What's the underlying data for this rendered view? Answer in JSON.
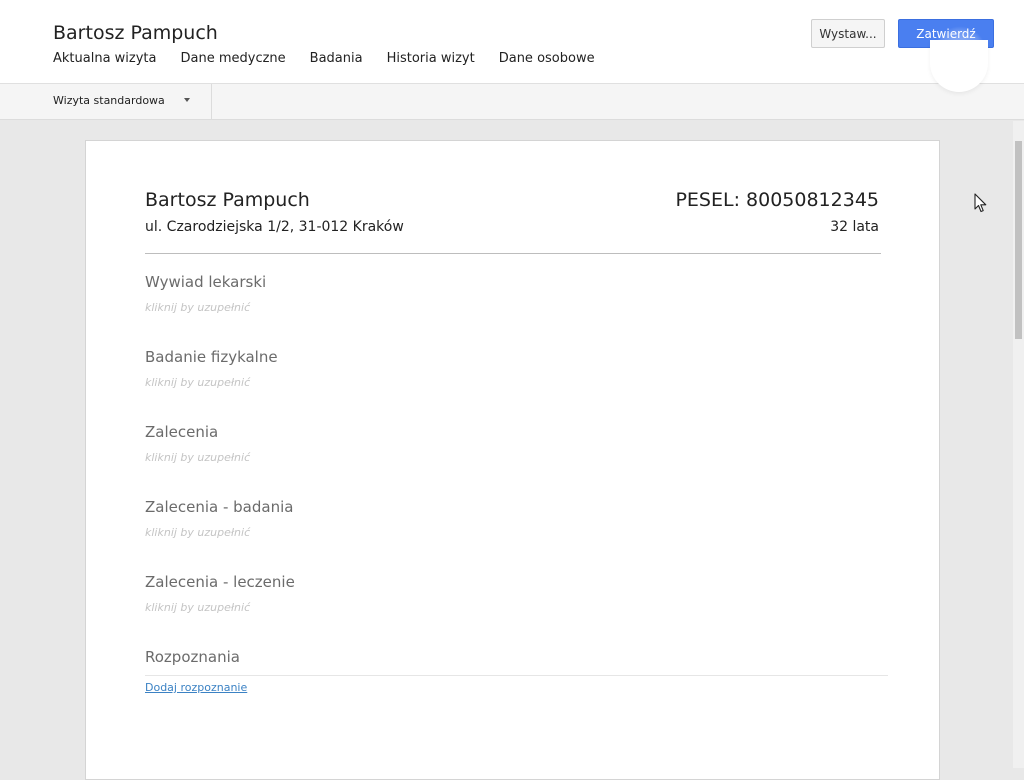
{
  "header": {
    "patient_name": "Bartosz Pampuch",
    "tabs": [
      {
        "label": "Aktualna wizyta"
      },
      {
        "label": "Dane medyczne"
      },
      {
        "label": "Badania"
      },
      {
        "label": "Historia wizyt"
      },
      {
        "label": "Dane osobowe"
      }
    ],
    "issue_button_label": "Wystaw...",
    "confirm_button_label": "Zatwierdź"
  },
  "toolbar": {
    "visit_type": "Wizyta standardowa"
  },
  "document": {
    "patient_name": "Bartosz Pampuch",
    "address": "ul. Czarodziejska 1/2, 31-012 Kraków",
    "pesel": "PESEL: 80050812345",
    "age": "32 lata",
    "sections": [
      {
        "title": "Wywiad lekarski",
        "placeholder": "kliknij by uzupełnić"
      },
      {
        "title": "Badanie fizykalne",
        "placeholder": "kliknij by uzupełnić"
      },
      {
        "title": "Zalecenia",
        "placeholder": "kliknij by uzupełnić"
      },
      {
        "title": "Zalecenia - badania",
        "placeholder": "kliknij by uzupełnić"
      },
      {
        "title": "Zalecenia - leczenie",
        "placeholder": "kliknij by uzupełnić"
      }
    ],
    "diagnoses_title": "Rozpoznania",
    "add_diagnosis_label": "Dodaj rozpoznanie"
  },
  "colors": {
    "accent": "#4a7ff0",
    "link": "#3b82c4",
    "placeholder": "#c4c4c4"
  }
}
